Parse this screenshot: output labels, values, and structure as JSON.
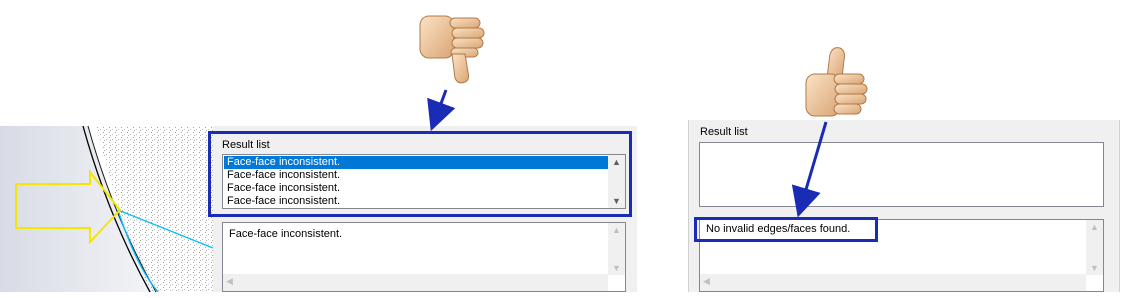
{
  "left_panel": {
    "result_label": "Result list",
    "items": [
      "Face-face inconsistent.",
      "Face-face inconsistent.",
      "Face-face inconsistent.",
      "Face-face inconsistent."
    ],
    "selected_index": 0,
    "message": "Face-face inconsistent."
  },
  "right_panel": {
    "result_label": "Result list",
    "message": "No invalid edges/faces found."
  },
  "icons": {
    "thumbs_down": "thumbs-down-icon",
    "thumbs_up": "thumbs-up-icon",
    "pointer_arrow": "arrow-pointer-icon",
    "highlight_arrow": "yellow-outline-arrow-icon"
  },
  "colors": {
    "highlight_box": "#1a2bb5",
    "selection": "#0078d7",
    "edge_highlight": "#00bfff",
    "arrow_outline": "#f5e600"
  }
}
